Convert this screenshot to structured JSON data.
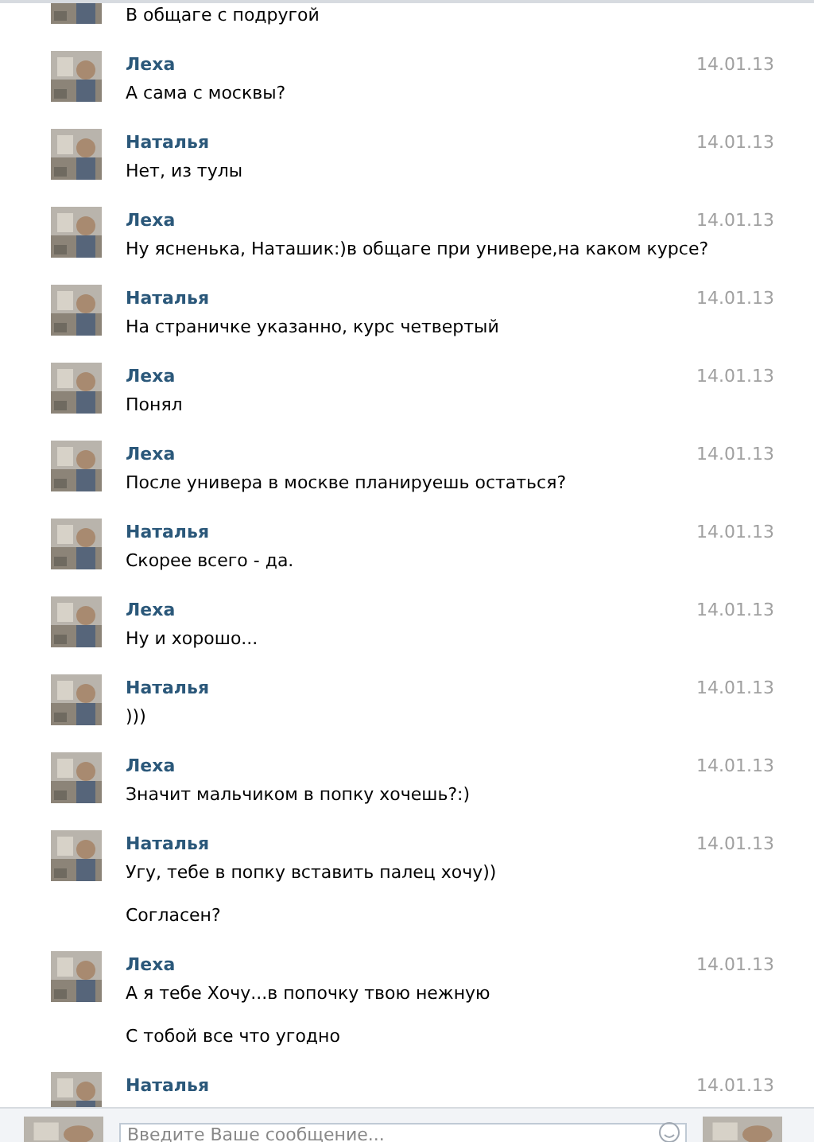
{
  "messages": [
    {
      "texts": [
        "В общаге с подругой"
      ]
    },
    {
      "name": "Леха",
      "date": "14.01.13",
      "texts": [
        "А сама с москвы?"
      ]
    },
    {
      "name": "Наталья",
      "date": "14.01.13",
      "texts": [
        "Нет, из тулы"
      ]
    },
    {
      "name": "Леха",
      "date": "14.01.13",
      "texts": [
        "Ну ясненька, Наташик:)в общаге при универе,на каком курсе?"
      ]
    },
    {
      "name": "Наталья",
      "date": "14.01.13",
      "texts": [
        "На страничке указанно, курс четвертый"
      ]
    },
    {
      "name": "Леха",
      "date": "14.01.13",
      "texts": [
        "Понял"
      ]
    },
    {
      "name": "Леха",
      "date": "14.01.13",
      "texts": [
        "После универа в москве планируешь остаться?"
      ]
    },
    {
      "name": "Наталья",
      "date": "14.01.13",
      "texts": [
        "Скорее всего - да."
      ]
    },
    {
      "name": "Леха",
      "date": "14.01.13",
      "texts": [
        "Ну и хорошо..."
      ]
    },
    {
      "name": "Наталья",
      "date": "14.01.13",
      "texts": [
        ")))"
      ]
    },
    {
      "name": "Леха",
      "date": "14.01.13",
      "texts": [
        "Значит мальчиком в попку хочешь?:)"
      ]
    },
    {
      "name": "Наталья",
      "date": "14.01.13",
      "texts": [
        "Угу, тебе в попку вставить палец хочу))",
        "Согласен?"
      ]
    },
    {
      "name": "Леха",
      "date": "14.01.13",
      "texts": [
        "А я тебе Хочу...в попочку твою нежную",
        "С тобой все что угодно"
      ]
    },
    {
      "name": "Наталья",
      "date": "14.01.13"
    }
  ],
  "composer": {
    "placeholder": "Введите Ваше сообщение..."
  }
}
